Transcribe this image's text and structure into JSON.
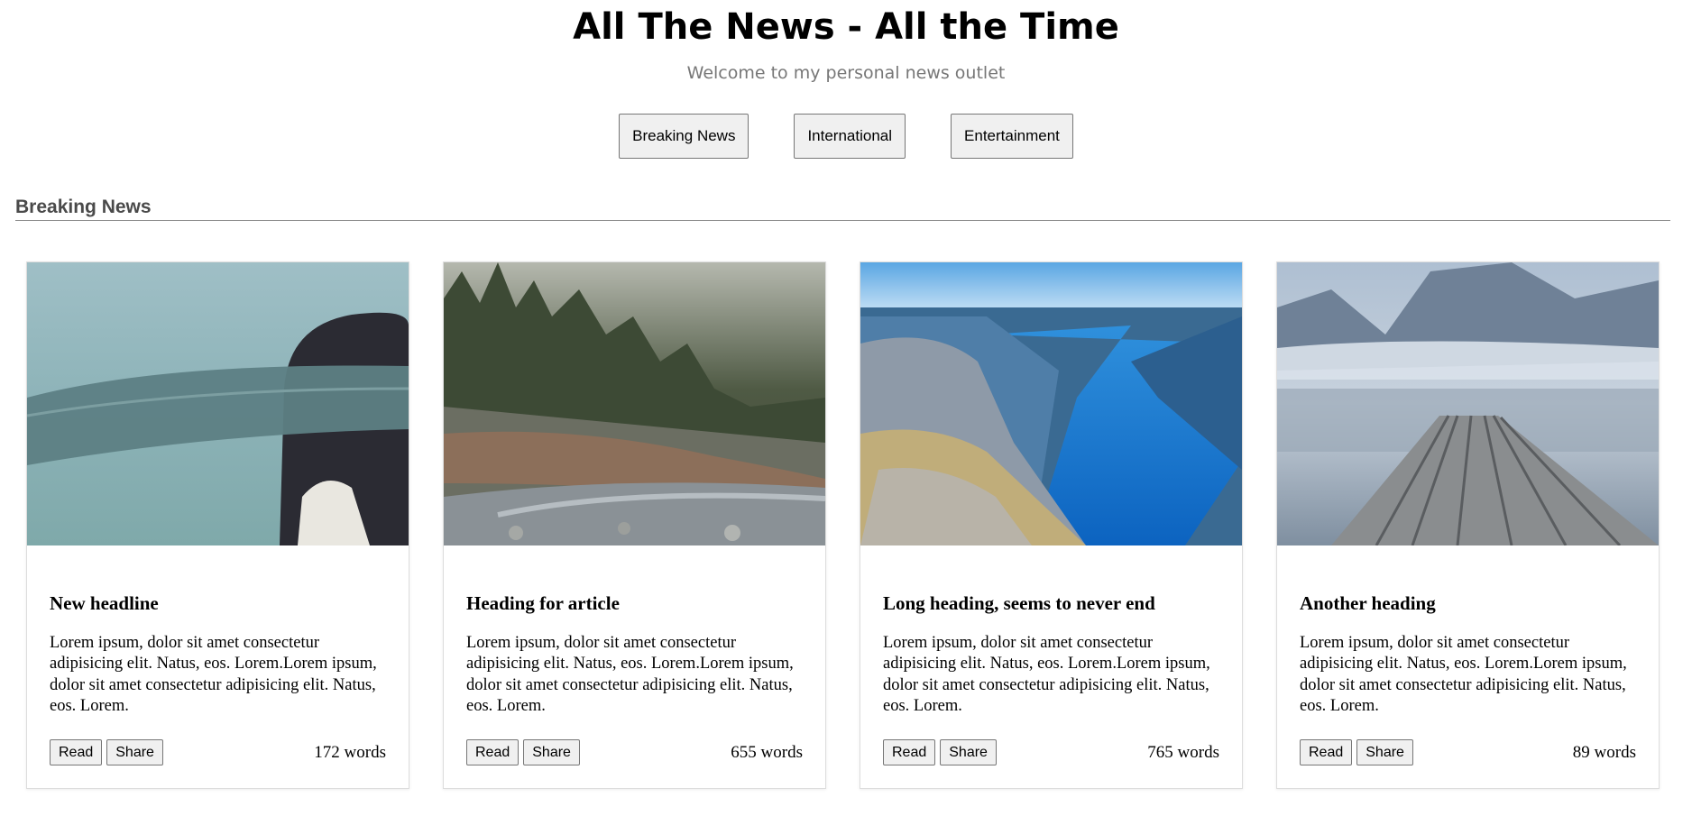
{
  "header": {
    "title": "All The News - All the Time",
    "subtitle": "Welcome to my personal news outlet"
  },
  "nav": {
    "items": [
      "Breaking News",
      "International",
      "Entertainment"
    ]
  },
  "section": {
    "title": "Breaking News"
  },
  "cards": [
    {
      "heading": "New headline",
      "text": "Lorem ipsum, dolor sit amet consectetur adipisicing elit. Natus, eos. Lorem.Lorem ipsum, dolor sit amet consectetur adipisicing elit. Natus, eos. Lorem.",
      "read_label": "Read",
      "share_label": "Share",
      "word_count": "172 words",
      "image": "person-with-blindfold-photo"
    },
    {
      "heading": "Heading for article",
      "text": "Lorem ipsum, dolor sit amet consectetur adipisicing elit. Natus, eos. Lorem.Lorem ipsum, dolor sit amet consectetur adipisicing elit. Natus, eos. Lorem.",
      "read_label": "Read",
      "share_label": "Share",
      "word_count": "655 words",
      "image": "forest-river-photo"
    },
    {
      "heading": "Long heading, seems to never end",
      "text": "Lorem ipsum, dolor sit amet consectetur adipisicing elit. Natus, eos. Lorem.Lorem ipsum, dolor sit amet consectetur adipisicing elit. Natus, eos. Lorem.",
      "read_label": "Read",
      "share_label": "Share",
      "word_count": "765 words",
      "image": "fjord-photo"
    },
    {
      "heading": "Another heading",
      "text": "Lorem ipsum, dolor sit amet consectetur adipisicing elit. Natus, eos. Lorem.Lorem ipsum, dolor sit amet consectetur adipisicing elit. Natus, eos. Lorem.",
      "read_label": "Read",
      "share_label": "Share",
      "word_count": "89 words",
      "image": "lake-pier-photo"
    }
  ]
}
